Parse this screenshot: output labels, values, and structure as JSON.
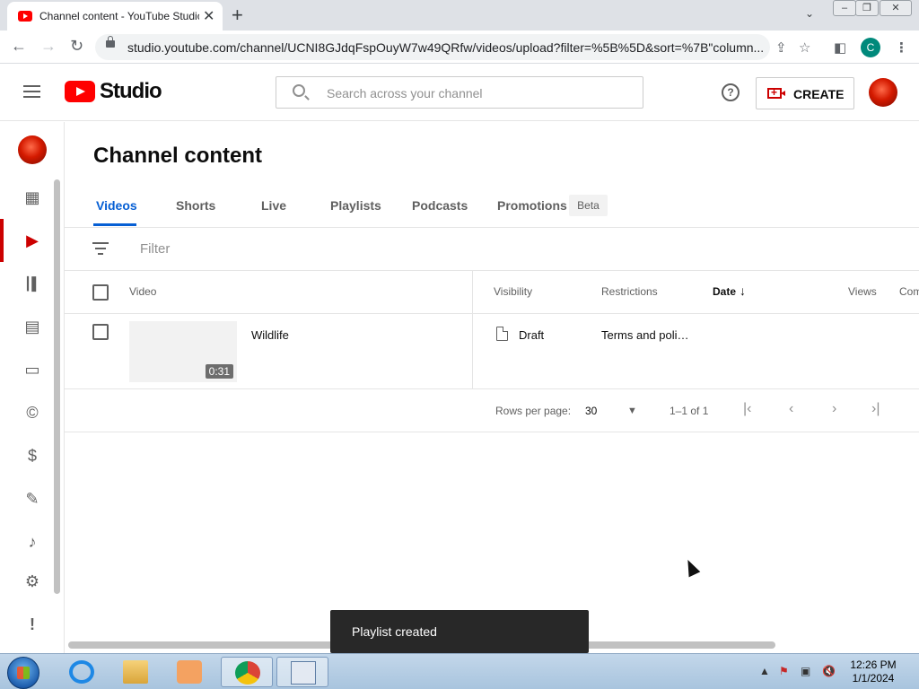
{
  "browser": {
    "tab_title": "Channel content - YouTube Studio",
    "tab_close": "✕",
    "new_tab": "+",
    "tab_list": "⌄",
    "url": "studio.youtube.com/channel/UCNI8GJdqFspOuyW7w49QRfw/videos/upload?filter=%5B%5D&sort=%7B\"column...",
    "profile_initial": "C",
    "window_controls": [
      "–",
      "❐",
      "✕"
    ]
  },
  "header": {
    "logo_text": "Studio",
    "search_placeholder": "Search across your channel",
    "help_label": "?",
    "create_label": "CREATE"
  },
  "sidebar": {
    "items": [
      {
        "icon": "dashboard-icon",
        "glyph": "▦"
      },
      {
        "icon": "content-icon",
        "glyph": "▶",
        "active": true
      },
      {
        "icon": "analytics-icon",
        "glyph": "📊"
      },
      {
        "icon": "comments-icon",
        "glyph": "▤"
      },
      {
        "icon": "subtitles-icon",
        "glyph": "▭"
      },
      {
        "icon": "copyright-icon",
        "glyph": "©"
      },
      {
        "icon": "earn-icon",
        "glyph": "$"
      },
      {
        "icon": "customization-icon",
        "glyph": "✎"
      },
      {
        "icon": "audio-library-icon",
        "glyph": "♪"
      },
      {
        "icon": "settings-icon",
        "glyph": "⚙"
      },
      {
        "icon": "feedback-icon",
        "glyph": "!"
      }
    ]
  },
  "main": {
    "page_title": "Channel content",
    "tabs": [
      {
        "label": "Videos",
        "active": true
      },
      {
        "label": "Shorts"
      },
      {
        "label": "Live"
      },
      {
        "label": "Playlists"
      },
      {
        "label": "Podcasts"
      },
      {
        "label": "Promotions"
      }
    ],
    "beta_badge": "Beta",
    "filter_placeholder": "Filter",
    "columns": {
      "video": "Video",
      "visibility": "Visibility",
      "restrictions": "Restrictions",
      "date": "Date",
      "date_sort_arrow": "↓",
      "views": "Views",
      "comments": "Com"
    },
    "rows": [
      {
        "title": "Wildlife",
        "duration": "0:31",
        "visibility": "Draft",
        "restrictions": "Terms and poli…",
        "date": "",
        "views": ""
      }
    ],
    "pagination": {
      "rows_per_page_label": "Rows per page:",
      "rows_per_page_value": "30",
      "dropdown_arrow": "▼",
      "range": "1–1 of 1",
      "first": "|‹",
      "prev": "‹",
      "next": "›",
      "last": "›|"
    }
  },
  "toast": {
    "message": "Playlist created"
  },
  "taskbar": {
    "time": "12:26 PM",
    "date": "1/1/2024",
    "apps": [
      "internet-explorer",
      "file-explorer",
      "media-player",
      "chrome",
      "keyboard-app"
    ]
  },
  "colors": {
    "accent_blue": "#065fd4",
    "brand_red": "#ff0000",
    "active_red": "#cc0000"
  }
}
